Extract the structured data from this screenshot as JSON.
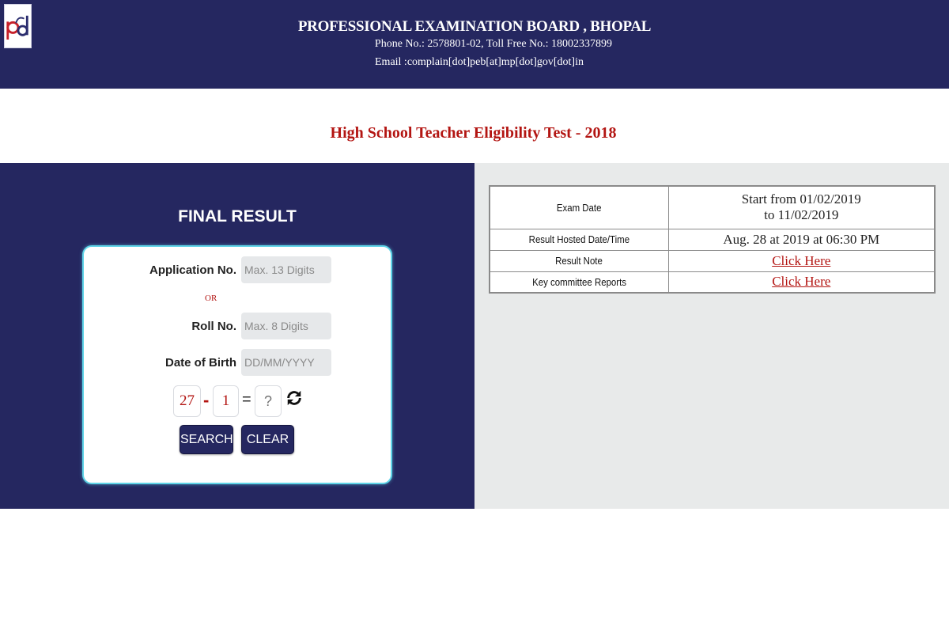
{
  "header": {
    "title": "PROFESSIONAL EXAMINATION BOARD , BHOPAL",
    "phone": "Phone No.: 2578801-02, Toll Free No.: 18002337899",
    "email": "Email :complain[dot]peb[at]mp[dot]gov[dot]in",
    "logo_icon": "peb-logo-icon"
  },
  "exam_title": "High School Teacher Eligibility Test - 2018",
  "form": {
    "heading": "FINAL RESULT",
    "application_label": "Application No.",
    "application_placeholder": "Max. 13 Digits",
    "or_text": "OR",
    "roll_label": "Roll No.",
    "roll_placeholder": "Max. 8 Digits",
    "dob_label": "Date of Birth",
    "dob_placeholder": "DD/MM/YYYY",
    "captcha": {
      "operand1": "27",
      "operator": "-",
      "operand2": "1",
      "equals": "=",
      "answer_placeholder": "?",
      "refresh_icon": "refresh-icon"
    },
    "search_label": "SEARCH",
    "clear_label": "CLEAR"
  },
  "info_table": {
    "rows": [
      {
        "label": "Exam Date",
        "value_line1": "Start from 01/02/2019",
        "value_line2": "to 11/02/2019"
      },
      {
        "label": "Result Hosted Date/Time",
        "value": "Aug. 28 at 2019 at 06:30 PM"
      },
      {
        "label": "Result Note",
        "link": "Click Here"
      },
      {
        "label": "Key committee Reports",
        "link": "Click Here"
      }
    ]
  },
  "colors": {
    "navy": "#252760",
    "accent_red": "#b31512",
    "card_border": "#5fd4e8",
    "right_panel_bg": "#e8eaea"
  }
}
